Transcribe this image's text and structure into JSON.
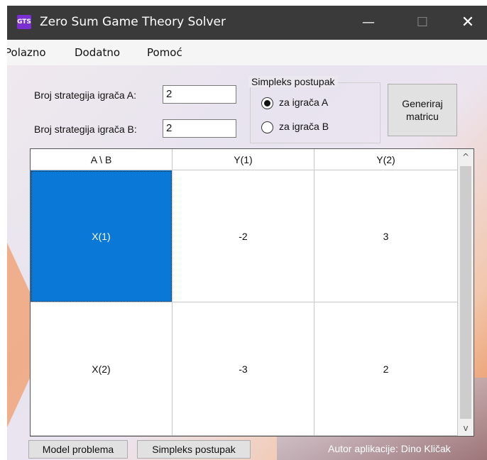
{
  "window": {
    "icon_text": "GTS",
    "title": "Zero Sum Game Theory Solver",
    "minimize_glyph": "—",
    "maximize_glyph": "☐",
    "close_glyph": "✕"
  },
  "menu": [
    "Polazno",
    "Dodatno",
    "Pomoć"
  ],
  "form": {
    "label_a": "Broj strategija igrača A:",
    "value_a": "2",
    "label_b": "Broj strategija igrača B:",
    "value_b": "2",
    "group_title": "Simpleks postupak",
    "radio_a": "za igrača A",
    "radio_b": "za igrača B",
    "radio_selected": "A",
    "generate_button": [
      "Generiraj",
      "matricu"
    ]
  },
  "matrix": {
    "header": [
      "A \\ B",
      "Y(1)",
      "Y(2)"
    ],
    "rows": [
      [
        "X(1)",
        "-2",
        "3"
      ],
      [
        "X(2)",
        "-3",
        "2"
      ]
    ],
    "selected_cell": "X(1)",
    "selection_color": "#0a78d7"
  },
  "scrollbar": {
    "up": "^",
    "down": "v"
  },
  "footer": {
    "model_button": "Model problema",
    "simplex_button": "Simpleks postupak",
    "author": "Autor aplikacije: Dino Kličak"
  }
}
